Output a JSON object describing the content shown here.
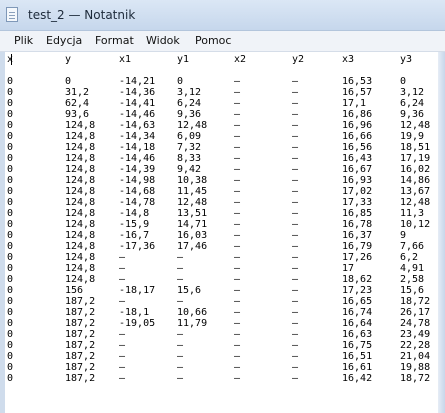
{
  "window": {
    "title": "test_2 — Notatnik"
  },
  "menu": [
    "Plik",
    "Edycja",
    "Format",
    "Widok",
    "Pomoc"
  ],
  "editor": {
    "header": [
      "x",
      "y",
      "x1",
      "y1",
      "x2",
      "y2",
      "x3",
      "y3"
    ],
    "rows": [
      [],
      [
        "0",
        "0",
        "-14,21",
        "0",
        "–",
        "–",
        "16,53",
        "0"
      ],
      [
        "0",
        "31,2",
        "-14,36",
        "3,12",
        "–",
        "–",
        "16,57",
        "3,12"
      ],
      [
        "0",
        "62,4",
        "-14,41",
        "6,24",
        "–",
        "–",
        "17,1",
        "6,24"
      ],
      [
        "0",
        "93,6",
        "-14,46",
        "9,36",
        "–",
        "–",
        "16,86",
        "9,36"
      ],
      [
        "0",
        "124,8",
        "-14,63",
        "12,48",
        "–",
        "–",
        "16,96",
        "12,48"
      ],
      [
        "0",
        "124,8",
        "-14,34",
        "6,09",
        "–",
        "–",
        "16,66",
        "19,9"
      ],
      [
        "0",
        "124,8",
        "-14,18",
        "7,32",
        "–",
        "–",
        "16,56",
        "18,51"
      ],
      [
        "0",
        "124,8",
        "-14,46",
        "8,33",
        "–",
        "–",
        "16,43",
        "17,19"
      ],
      [
        "0",
        "124,8",
        "-14,39",
        "9,42",
        "–",
        "–",
        "16,67",
        "16,02"
      ],
      [
        "0",
        "124,8",
        "-14,98",
        "10,38",
        "–",
        "–",
        "16,93",
        "14,86"
      ],
      [
        "0",
        "124,8",
        "-14,68",
        "11,45",
        "–",
        "–",
        "17,02",
        "13,67"
      ],
      [
        "0",
        "124,8",
        "-14,78",
        "12,48",
        "–",
        "–",
        "17,33",
        "12,48"
      ],
      [
        "0",
        "124,8",
        "-14,8",
        "13,51",
        "–",
        "–",
        "16,85",
        "11,3"
      ],
      [
        "0",
        "124,8",
        "-15,9",
        "14,71",
        "–",
        "–",
        "16,78",
        "10,12"
      ],
      [
        "0",
        "124,8",
        "-16,7",
        "16,03",
        "–",
        "–",
        "16,37",
        "9"
      ],
      [
        "0",
        "124,8",
        "-17,36",
        "17,46",
        "–",
        "–",
        "16,79",
        "7,66"
      ],
      [
        "0",
        "124,8",
        "–",
        "–",
        "–",
        "–",
        "17,26",
        "6,2"
      ],
      [
        "0",
        "124,8",
        "–",
        "–",
        "–",
        "–",
        "17",
        "4,91"
      ],
      [
        "0",
        "124,8",
        "–",
        "–",
        "–",
        "–",
        "18,62",
        "2,58"
      ],
      [
        "0",
        "156",
        "-18,17",
        "15,6",
        "–",
        "–",
        "17,23",
        "15,6"
      ],
      [
        "0",
        "187,2",
        "–",
        "–",
        "–",
        "–",
        "16,65",
        "18,72"
      ],
      [
        "0",
        "187,2",
        "-18,1",
        "10,66",
        "–",
        "–",
        "16,74",
        "26,17"
      ],
      [
        "0",
        "187,2",
        "-19,05",
        "11,79",
        "–",
        "–",
        "16,64",
        "24,78"
      ],
      [
        "0",
        "187,2",
        "–",
        "–",
        "–",
        "–",
        "16,63",
        "23,49"
      ],
      [
        "0",
        "187,2",
        "–",
        "–",
        "–",
        "–",
        "16,75",
        "22,28"
      ],
      [
        "0",
        "187,2",
        "–",
        "–",
        "–",
        "–",
        "16,51",
        "21,04"
      ],
      [
        "0",
        "187,2",
        "–",
        "–",
        "–",
        "–",
        "16,61",
        "19,88"
      ],
      [
        "0",
        "187,2",
        "–",
        "–",
        "–",
        "–",
        "16,42",
        "18,72"
      ]
    ]
  }
}
